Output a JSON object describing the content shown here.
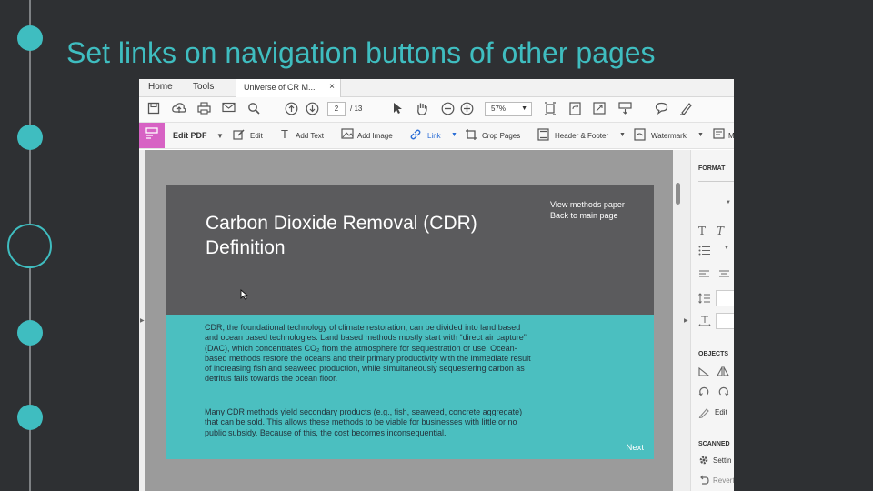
{
  "slide": {
    "title": "Set links on navigation buttons of other pages"
  },
  "app": {
    "tabs": {
      "home": "Home",
      "tools": "Tools",
      "document": "Universe of CR M...",
      "close_glyph": "×"
    },
    "toolbar": {
      "current_page": "2",
      "total_pages": "/ 13",
      "zoom": "57%"
    },
    "edit_toolbar": {
      "edit_pdf": "Edit PDF",
      "edit": "Edit",
      "add_text": "Add Text",
      "add_image": "Add Image",
      "link": "Link",
      "crop_pages": "Crop Pages",
      "header_footer": "Header & Footer",
      "watermark": "Watermark",
      "more": "M"
    },
    "right_panel": {
      "format": "FORMAT",
      "objects": "OBJECTS",
      "edit_label": "Edit",
      "scanned": "SCANNED",
      "settings_label": "Settin",
      "revert_label": "Revert"
    }
  },
  "document_page": {
    "heading_line1": "Carbon Dioxide Removal (CDR)",
    "heading_line2": "Definition",
    "link_methods": "View methods paper",
    "link_main": "Back to main page",
    "para1_lines": [
      "CDR, the foundational technology of climate restoration, can be divided into land based",
      "and ocean based technologies. Land based methods mostly start with “direct air capture”",
      "(DAC), which concentrates CO₂ from the atmosphere for sequestration or use. Ocean-",
      "based methods restore the oceans and their primary productivity with the immediate result",
      "of increasing fish and seaweed production, while simultaneously sequestering carbon as",
      "detritus falls towards the ocean floor."
    ],
    "para2_lines": [
      "Many CDR methods yield secondary products (e.g., fish, seaweed, concrete aggregate)",
      "that can be sold. This allows these methods to be viable for businesses with little or no",
      "public subsidy. Because of this, the cost becomes inconsequential."
    ],
    "next_label": "Next"
  },
  "colors": {
    "background": "#2e3033",
    "accent_teal": "#3fbdc0",
    "page_dark": "#5b5b5d",
    "page_teal": "#4bbfc0",
    "edit_pdf_pink": "#d762c4"
  }
}
